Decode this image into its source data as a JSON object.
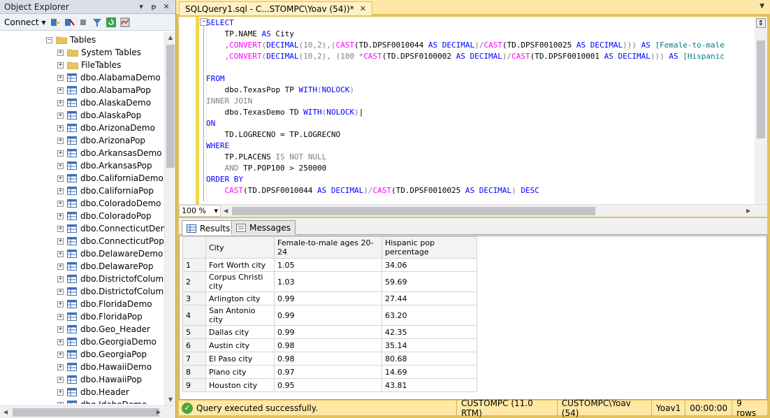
{
  "object_explorer": {
    "title": "Object Explorer",
    "pin_label": "▼ ᵽ ✕",
    "connect_label": "Connect",
    "tables_root": "Tables",
    "items": [
      "System Tables",
      "FileTables",
      "dbo.AlabamaDemo",
      "dbo.AlabamaPop",
      "dbo.AlaskaDemo",
      "dbo.AlaskaPop",
      "dbo.ArizonaDemo",
      "dbo.ArizonaPop",
      "dbo.ArkansasDemo",
      "dbo.ArkansasPop",
      "dbo.CaliforniaDemo",
      "dbo.CaliforniaPop",
      "dbo.ColoradoDemo",
      "dbo.ColoradoPop",
      "dbo.ConnecticutDem",
      "dbo.ConnecticutPop",
      "dbo.DelawareDemo",
      "dbo.DelawarePop",
      "dbo.DistrictofColumb",
      "dbo.DistrictofColumb",
      "dbo.FloridaDemo",
      "dbo.FloridaPop",
      "dbo.Geo_Header",
      "dbo.GeorgiaDemo",
      "dbo.GeorgiaPop",
      "dbo.HawaiiDemo",
      "dbo.HawaiiPop",
      "dbo.Header",
      "dbo.IdahoDemo"
    ]
  },
  "editor": {
    "tab_title": "SQLQuery1.sql - C...STOMPC\\Yoav (54))*",
    "zoom": "100 %",
    "code": {
      "select": "SELECT",
      "l2_a": "TP.NAME ",
      "l2_as": "AS",
      "l2_b": " City",
      "l3_comma": ",",
      "l3_convert": "CONVERT",
      "l3_p1": "(",
      "l3_decimal": "DECIMAL",
      "l3_p2": "(10,2),(",
      "l3_cast1": "CAST",
      "l3_p3": "(TD.DPSF0010044 ",
      "l3_as1": "AS",
      "l3_dec1": " DECIMAL",
      "l3_p4": ")/",
      "l3_cast2": "CAST",
      "l3_p5": "(TD.DPSF0010025 ",
      "l3_as2": "AS",
      "l3_dec2": " DECIMAL",
      "l3_p6": "))) ",
      "l3_as3": "AS",
      "l3_alias": " [Female-to-male",
      "l4_comma": ",",
      "l4_convert": "CONVERT",
      "l4_p1": "(",
      "l4_decimal": "DECIMAL",
      "l4_p2": "(10,2), (100 *",
      "l4_cast1": "CAST",
      "l4_p3": "(TD.DPSF0100002 ",
      "l4_as1": "AS",
      "l4_dec1": " DECIMAL",
      "l4_p4": ")/",
      "l4_cast2": "CAST",
      "l4_p5": "(TD.DPSF0010001 ",
      "l4_as2": "AS",
      "l4_dec2": " DECIMAL",
      "l4_p6": "))) ",
      "l4_as3": "AS",
      "l4_alias": " [Hispanic",
      "from": "FROM",
      "l7_a": "dbo.TexasPop TP ",
      "l7_with": "WITH",
      "l7_b": "(",
      "l7_nolock": "NOLOCK",
      "l7_c": ")",
      "inner_join": "INNER JOIN",
      "l9_a": "dbo.TexasDemo TD ",
      "l9_with": "WITH",
      "l9_b": "(",
      "l9_nolock": "NOLOCK",
      "l9_c": ")",
      "on": "ON",
      "l11": "TD.LOGRECNO = TP.LOGRECNO",
      "where": "WHERE",
      "l13_a": "TP.PLACENS ",
      "l13_is": "IS NOT NULL",
      "l14_and": "AND",
      "l14_b": " TP.POP100 > 250000",
      "order_by": "ORDER BY",
      "l16_cast1": "CAST",
      "l16_p1": "(TD.DPSF0010044 ",
      "l16_as1": "AS",
      "l16_dec1": " DECIMAL",
      "l16_p2": ")/",
      "l16_cast2": "CAST",
      "l16_p3": "(TD.DPSF0010025 ",
      "l16_as2": "AS",
      "l16_dec2": " DECIMAL",
      "l16_p4": ") ",
      "l16_desc": "DESC"
    }
  },
  "results": {
    "tabs": [
      "Results",
      "Messages"
    ],
    "columns": [
      "City",
      "Female-to-male ages 20-24",
      "Hispanic pop percentage"
    ],
    "rows": [
      [
        "1",
        "Fort Worth city",
        "1.05",
        "34.06"
      ],
      [
        "2",
        "Corpus Christi city",
        "1.03",
        "59.69"
      ],
      [
        "3",
        "Arlington city",
        "0.99",
        "27.44"
      ],
      [
        "4",
        "San Antonio city",
        "0.99",
        "63.20"
      ],
      [
        "5",
        "Dallas city",
        "0.99",
        "42.35"
      ],
      [
        "6",
        "Austin city",
        "0.98",
        "35.14"
      ],
      [
        "7",
        "El Paso city",
        "0.98",
        "80.68"
      ],
      [
        "8",
        "Plano city",
        "0.97",
        "14.69"
      ],
      [
        "9",
        "Houston city",
        "0.95",
        "43.81"
      ]
    ]
  },
  "status": {
    "message": "Query executed successfully.",
    "server": "CUSTOMPC (11.0 RTM)",
    "user": "CUSTOMPC\\Yoav (54)",
    "database": "Yoav1",
    "elapsed": "00:00:00",
    "rows": "9 rows"
  },
  "colors": {
    "accent": "#ffe8a6",
    "frame": "#e2c15a",
    "keyword": "#0000ff",
    "function": "#ff00ff",
    "operator": "#808080"
  }
}
